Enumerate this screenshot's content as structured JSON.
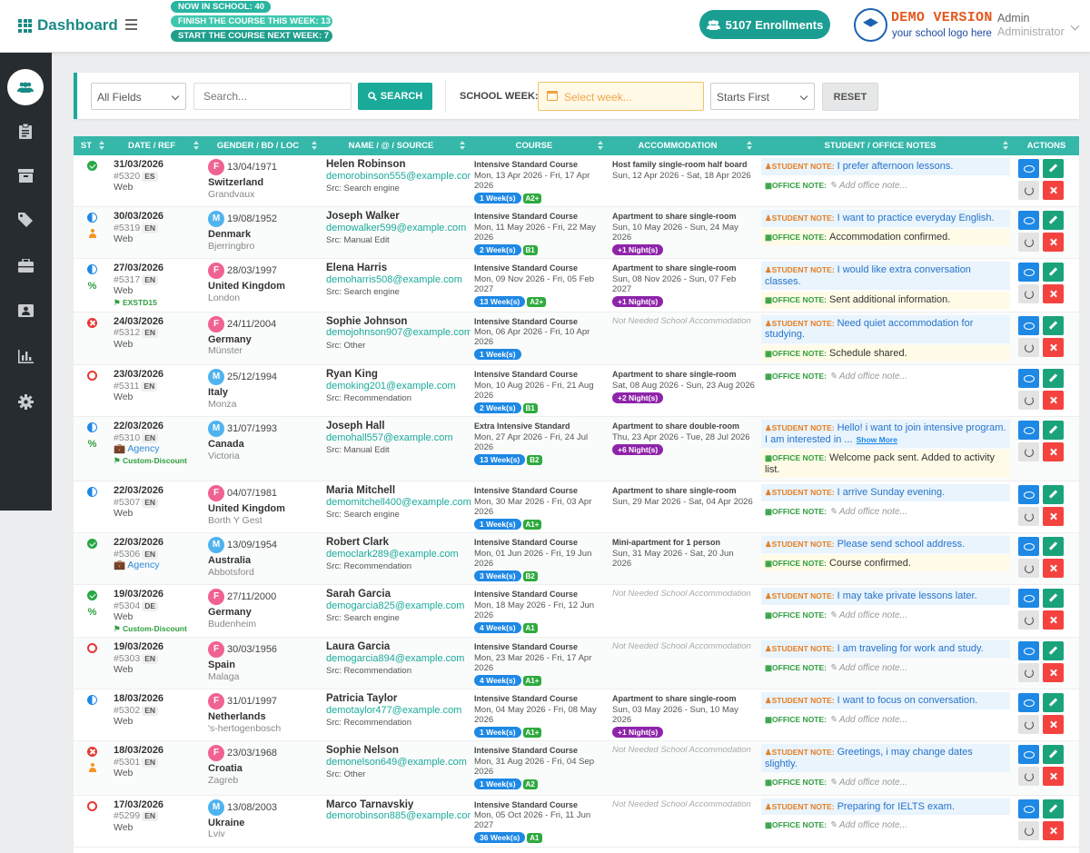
{
  "header": {
    "brand": "Dashboard",
    "badges": {
      "now_in_school": "NOW IN SCHOOL: 40",
      "finish_week": "FINISH THE COURSE THIS WEEK: 13",
      "start_next_week": "START THE COURSE NEXT WEEK: 7"
    },
    "enrollments": "5107 Enrollments",
    "logo_title": "DEMO VERSION",
    "logo_sub": "your school logo here",
    "user_name": "Admin",
    "user_role": "Administrator"
  },
  "sidebar": {
    "items": [
      "users-icon",
      "clipboard-icon",
      "archive-icon",
      "tag-icon",
      "briefcase-icon",
      "contact-card-icon",
      "bar-chart-icon",
      "gear-icon"
    ]
  },
  "filters": {
    "field_select": "All Fields",
    "search_placeholder": "Search...",
    "search_button": "SEARCH",
    "school_week_label": "SCHOOL WEEK:",
    "week_placeholder": "Select week...",
    "sort_select": "Starts First",
    "reset_button": "RESET"
  },
  "table": {
    "columns": [
      "ST",
      "DATE / REF",
      "GENDER / BD / LOC",
      "NAME / @ / SOURCE",
      "COURSE",
      "ACCOMMODATION",
      "STUDENT / OFFICE NOTES",
      "ACTIONS"
    ],
    "student_note_label": "STUDENT NOTE:",
    "office_note_label": "OFFICE NOTE:",
    "office_placeholder": "Add office note...",
    "show_more": "Show More",
    "rows": [
      {
        "status": "check",
        "extra": "",
        "date": "31/03/2026",
        "ref": "#5320",
        "lang": "ES",
        "channel": "Web",
        "agency": "",
        "discount": "",
        "gender": "F",
        "bd": "13/04/1971",
        "country": "Switzerland",
        "city": "Grandvaux",
        "name": "Helen Robinson",
        "email": "demorobinson555@example.com",
        "source": "Src: Search engine",
        "course": "Intensive Standard Course",
        "course_dates": "Mon, 13 Apr 2026 - Fri, 17 Apr 2026",
        "weeks": "1 Week(s)",
        "level": "A2+",
        "accom": "Host family single-room half board",
        "accom_dates": "Sun, 12 Apr 2026 - Sat, 18 Apr 2026",
        "nights": "",
        "student_note": "I prefer afternoon lessons.",
        "office_note": ""
      },
      {
        "status": "half",
        "extra": "person",
        "date": "30/03/2026",
        "ref": "#5319",
        "lang": "EN",
        "channel": "Web",
        "agency": "",
        "discount": "",
        "gender": "M",
        "bd": "19/08/1952",
        "country": "Denmark",
        "city": "Bjerringbro",
        "name": "Joseph Walker",
        "email": "demowalker599@example.com",
        "source": "Src: Manual Edit",
        "course": "Intensive Standard Course",
        "course_dates": "Mon, 11 May 2026 - Fri, 22 May 2026",
        "weeks": "2 Week(s)",
        "level": "B1",
        "accom": "Apartment to share single-room",
        "accom_dates": "Sun, 10 May 2026 - Sun, 24 May 2026",
        "nights": "+1 Night(s)",
        "student_note": "I want to practice everyday English.",
        "office_note": "Accommodation confirmed."
      },
      {
        "status": "half",
        "extra": "pct",
        "date": "27/03/2026",
        "ref": "#5317",
        "lang": "EN",
        "channel": "Web",
        "agency": "",
        "discount": "EXSTD15",
        "gender": "F",
        "bd": "28/03/1997",
        "country": "United Kingdom",
        "city": "London",
        "name": "Elena Harris",
        "email": "demoharris508@example.com",
        "source": "Src: Search engine",
        "course": "Intensive Standard Course",
        "course_dates": "Mon, 09 Nov 2026 - Fri, 05 Feb 2027",
        "weeks": "13 Week(s)",
        "level": "A2+",
        "accom": "Apartment to share single-room",
        "accom_dates": "Sun, 08 Nov 2026 - Sun, 07 Feb 2027",
        "nights": "+1 Night(s)",
        "student_note": "I would like extra conversation classes.",
        "office_note": "Sent additional information."
      },
      {
        "status": "x",
        "extra": "",
        "date": "24/03/2026",
        "ref": "#5312",
        "lang": "EN",
        "channel": "Web",
        "agency": "",
        "discount": "",
        "gender": "F",
        "bd": "24/11/2004",
        "country": "Germany",
        "city": "Münster",
        "name": "Sophie Johnson",
        "email": "demojohnson907@example.com",
        "source": "Src: Other",
        "course": "Intensive Standard Course",
        "course_dates": "Mon, 06 Apr 2026 - Fri, 10 Apr 2026",
        "weeks": "1 Week(s)",
        "level": "",
        "accom": "",
        "accom_dates": "",
        "nights": "",
        "student_note": "Need quiet accommodation for studying.",
        "office_note": "Schedule shared."
      },
      {
        "status": "ring",
        "extra": "",
        "date": "23/03/2026",
        "ref": "#5311",
        "lang": "EN",
        "channel": "Web",
        "agency": "",
        "discount": "",
        "gender": "M",
        "bd": "25/12/1994",
        "country": "Italy",
        "city": "Monza",
        "name": "Ryan King",
        "email": "demoking201@example.com",
        "source": "Src: Recommendation",
        "course": "Intensive Standard Course",
        "course_dates": "Mon, 10 Aug 2026 - Fri, 21 Aug 2026",
        "weeks": "2 Week(s)",
        "level": "B1",
        "accom": "Apartment to share single-room",
        "accom_dates": "Sat, 08 Aug 2026 - Sun, 23 Aug 2026",
        "nights": "+2 Night(s)",
        "student_note": "",
        "office_note": ""
      },
      {
        "status": "half",
        "extra": "pct",
        "date": "22/03/2026",
        "ref": "#5310",
        "lang": "EN",
        "channel": "",
        "agency": "Agency",
        "discount": "Custom-Discount",
        "gender": "M",
        "bd": "31/07/1993",
        "country": "Canada",
        "city": "Victoria",
        "name": "Joseph Hall",
        "email": "demohall557@example.com",
        "source": "Src: Manual Edit",
        "course": "Extra Intensive Standard",
        "course_dates": "Mon, 27 Apr 2026 - Fri, 24 Jul 2026",
        "weeks": "13 Week(s)",
        "level": "B2",
        "accom": "Apartment to share double-room",
        "accom_dates": "Thu, 23 Apr 2026 - Tue, 28 Jul 2026",
        "nights": "+6 Night(s)",
        "student_note": "Hello! i want to join intensive program. I am interested in ...",
        "office_note": "Welcome pack sent. Added to activity list."
      },
      {
        "status": "half",
        "extra": "",
        "date": "22/03/2026",
        "ref": "#5307",
        "lang": "EN",
        "channel": "Web",
        "agency": "",
        "discount": "",
        "gender": "F",
        "bd": "04/07/1981",
        "country": "United Kingdom",
        "city": "Borth Y Gest",
        "name": "Maria Mitchell",
        "email": "demomitchell400@example.com",
        "source": "Src: Search engine",
        "course": "Intensive Standard Course",
        "course_dates": "Mon, 30 Mar 2026 - Fri, 03 Apr 2026",
        "weeks": "1 Week(s)",
        "level": "A1+",
        "accom": "Apartment to share single-room",
        "accom_dates": "Sun, 29 Mar 2026 - Sat, 04 Apr 2026",
        "nights": "",
        "student_note": "I arrive Sunday evening.",
        "office_note": ""
      },
      {
        "status": "check",
        "extra": "",
        "date": "22/03/2026",
        "ref": "#5306",
        "lang": "EN",
        "channel": "",
        "agency": "Agency",
        "discount": "",
        "gender": "M",
        "bd": "13/09/1954",
        "country": "Australia",
        "city": "Abbotsford",
        "name": "Robert Clark",
        "email": "democlark289@example.com",
        "source": "Src: Recommendation",
        "course": "Intensive Standard Course",
        "course_dates": "Mon, 01 Jun 2026 - Fri, 19 Jun 2026",
        "weeks": "3 Week(s)",
        "level": "B2",
        "accom": "Mini-apartment for 1 person",
        "accom_dates": "Sun, 31 May 2026 - Sat, 20 Jun 2026",
        "nights": "",
        "student_note": "Please send school address.",
        "office_note": "Course confirmed."
      },
      {
        "status": "check",
        "extra": "pct",
        "date": "19/03/2026",
        "ref": "#5304",
        "lang": "DE",
        "channel": "Web",
        "agency": "",
        "discount": "Custom-Discount",
        "gender": "F",
        "bd": "27/11/2000",
        "country": "Germany",
        "city": "Budenheim",
        "name": "Sarah Garcia",
        "email": "demogarcia825@example.com",
        "source": "Src: Search engine",
        "course": "Intensive Standard Course",
        "course_dates": "Mon, 18 May 2026 - Fri, 12 Jun 2026",
        "weeks": "4 Week(s)",
        "level": "A1",
        "accom": "",
        "accom_dates": "",
        "nights": "",
        "student_note": "I may take private lessons later.",
        "office_note": ""
      },
      {
        "status": "ring",
        "extra": "",
        "date": "19/03/2026",
        "ref": "#5303",
        "lang": "EN",
        "channel": "Web",
        "agency": "",
        "discount": "",
        "gender": "F",
        "bd": "30/03/1956",
        "country": "Spain",
        "city": "Malaga",
        "name": "Laura Garcia",
        "email": "demogarcia894@example.com",
        "source": "Src: Recommendation",
        "course": "Intensive Standard Course",
        "course_dates": "Mon, 23 Mar 2026 - Fri, 17 Apr 2026",
        "weeks": "4 Week(s)",
        "level": "A1+",
        "accom": "",
        "accom_dates": "",
        "nights": "",
        "student_note": "I am traveling for work and study.",
        "office_note": ""
      },
      {
        "status": "half",
        "extra": "",
        "date": "18/03/2026",
        "ref": "#5302",
        "lang": "EN",
        "channel": "Web",
        "agency": "",
        "discount": "",
        "gender": "F",
        "bd": "31/01/1997",
        "country": "Netherlands",
        "city": "'s-hertogenbosch",
        "name": "Patricia Taylor",
        "email": "demotaylor477@example.com",
        "source": "Src: Recommendation",
        "course": "Intensive Standard Course",
        "course_dates": "Mon, 04 May 2026 - Fri, 08 May 2026",
        "weeks": "1 Week(s)",
        "level": "A1+",
        "accom": "Apartment to share single-room",
        "accom_dates": "Sun, 03 May 2026 - Sun, 10 May 2026",
        "nights": "+1 Night(s)",
        "student_note": "I want to focus on conversation.",
        "office_note": ""
      },
      {
        "status": "x",
        "extra": "person",
        "date": "18/03/2026",
        "ref": "#5301",
        "lang": "EN",
        "channel": "Web",
        "agency": "",
        "discount": "",
        "gender": "F",
        "bd": "23/03/1968",
        "country": "Croatia",
        "city": "Zagreb",
        "name": "Sophie Nelson",
        "email": "demonelson649@example.com",
        "source": "Src: Other",
        "course": "Intensive Standard Course",
        "course_dates": "Mon, 31 Aug 2026 - Fri, 04 Sep 2026",
        "weeks": "1 Week(s)",
        "level": "A2",
        "accom": "",
        "accom_dates": "",
        "nights": "",
        "student_note": "Greetings, i may change dates slightly.",
        "office_note": ""
      },
      {
        "status": "ring",
        "extra": "",
        "date": "17/03/2026",
        "ref": "#5299",
        "lang": "EN",
        "channel": "Web",
        "agency": "",
        "discount": "",
        "gender": "M",
        "bd": "13/08/2003",
        "country": "Ukraine",
        "city": "Lviv",
        "name": "Marco Tarnavskiy",
        "email": "demorobinson885@example.com",
        "source": "",
        "course": "Intensive Standard Course",
        "course_dates": "Mon, 05 Oct 2026 - Fri, 11 Jun 2027",
        "weeks": "36 Week(s)",
        "level": "A1",
        "accom": "",
        "accom_dates": "",
        "nights": "",
        "student_note": "Preparing for IELTS exam.",
        "office_note": ""
      }
    ]
  }
}
